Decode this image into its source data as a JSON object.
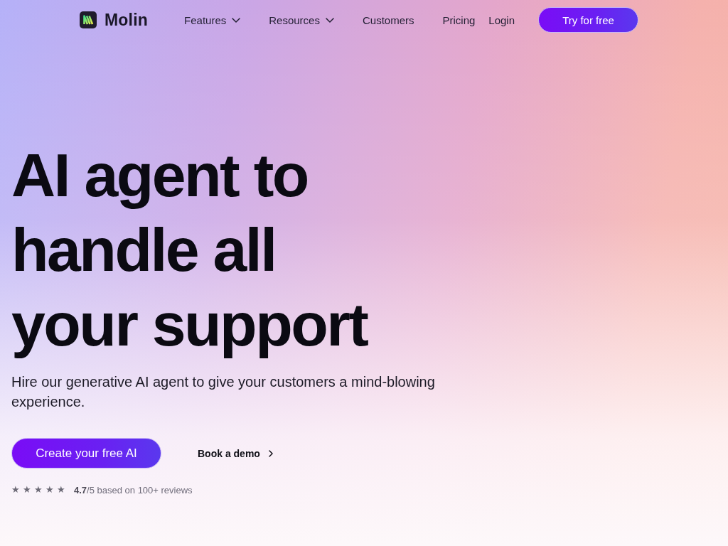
{
  "nav": {
    "brand": "Molin",
    "links": [
      {
        "label": "Features",
        "dropdown": true
      },
      {
        "label": "Resources",
        "dropdown": true
      },
      {
        "label": "Customers",
        "dropdown": false
      },
      {
        "label": "Pricing",
        "dropdown": false
      }
    ],
    "login": "Login",
    "cta": "Try for free"
  },
  "hero": {
    "headline": "AI agent to handle all your support",
    "subtitle": "Hire our generative AI agent to give your customers a mind-blowing experience.",
    "primary_button": "Create your free AI",
    "secondary_link": "Book a demo",
    "rating": {
      "stars": 5,
      "text": "**4.7**/5 based on 100+ reviews"
    }
  }
}
